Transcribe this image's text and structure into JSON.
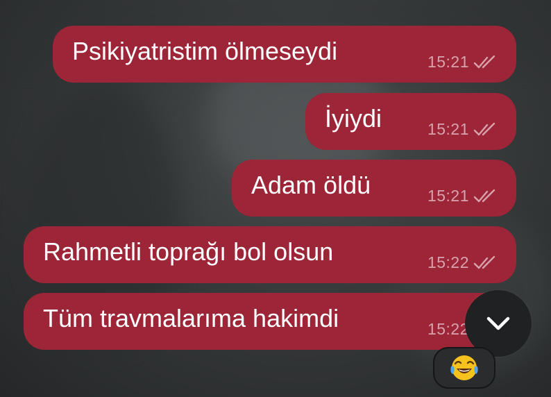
{
  "messages": [
    {
      "text": "Psikiyatristim ölmeseydi",
      "time": "15:21",
      "status": "read"
    },
    {
      "text": "İyiydi",
      "time": "15:21",
      "status": "read"
    },
    {
      "text": "Adam öldü",
      "time": "15:21",
      "status": "read"
    },
    {
      "text": "Rahmetli toprağı bol olsun",
      "time": "15:22",
      "status": "read"
    },
    {
      "text": "Tüm travmalarıma hakimdi",
      "time": "15:22",
      "status": "read"
    }
  ],
  "scroll_button": {
    "icon": "chevron-down-icon"
  },
  "reaction": {
    "emoji": "😂",
    "icon": "tears-of-joy-emoji-icon"
  },
  "colors": {
    "bubble": "#9c2537",
    "text": "#ffffff",
    "time": "#d9a3ad",
    "scroll_button": "#1f2122"
  }
}
